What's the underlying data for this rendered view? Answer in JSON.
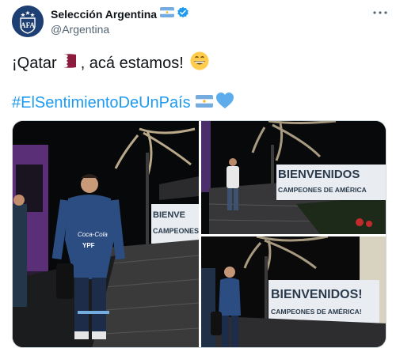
{
  "account": {
    "display_name": "Selección Argentina",
    "handle": "@Argentina",
    "avatar_text": "AFA"
  },
  "tweet": {
    "line1_part1": "¡Qatar",
    "line1_part2": ", acá estamos!",
    "hashtag": "#ElSentimientoDeUnPaís"
  },
  "media": {
    "photo_signs": {
      "p1_line1": "BIENVE",
      "p1_line2": "CAMPEONES",
      "p2_line1": "BIENVENIDOS",
      "p2_line2": "CAMPEONES DE AMÉRICA",
      "p3_line1": "BIENVENIDOS!",
      "p3_line2": "CAMPEONES DE AMÉRICA!"
    },
    "shirt_text": {
      "brand": "Coca-Cola",
      "sponsor": "YPF"
    }
  },
  "colors": {
    "hashtag": "#1d9bf0",
    "verified": "#1d9bf0",
    "avatar_bg": "#1d3f73",
    "argentina_blue": "#74acdf"
  },
  "icons": {
    "more": "more-horizontal-icon",
    "verified": "verified-badge-icon"
  }
}
